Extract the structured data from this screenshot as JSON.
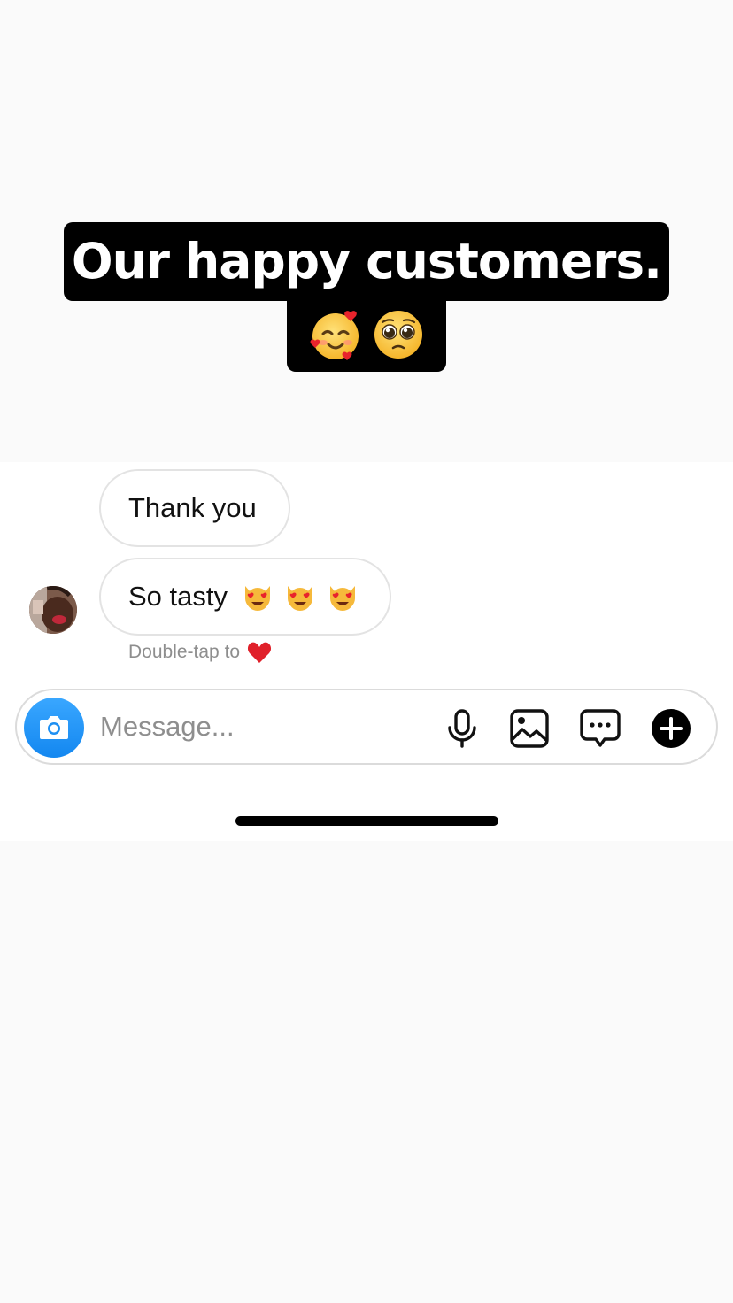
{
  "story": {
    "caption_line1": "Our happy customers.",
    "caption_emojis": [
      "smiling-face-with-hearts",
      "pleading-face"
    ]
  },
  "chat": {
    "messages": [
      {
        "text": "Thank you"
      },
      {
        "text": "So tasty",
        "emojis": [
          "heart-eyes-cat",
          "heart-eyes-cat",
          "heart-eyes-cat"
        ]
      }
    ],
    "reaction_hint": "Double-tap to",
    "reaction_emoji": "red-heart"
  },
  "composer": {
    "placeholder": "Message...",
    "icons": [
      "camera-icon",
      "microphone-icon",
      "gallery-icon",
      "sticker-icon",
      "plus-icon"
    ]
  },
  "colors": {
    "camera_button": "#1e90f5",
    "bubble_border": "#e3e3e3",
    "caption_background": "#000000",
    "heart": "#e0202a"
  }
}
